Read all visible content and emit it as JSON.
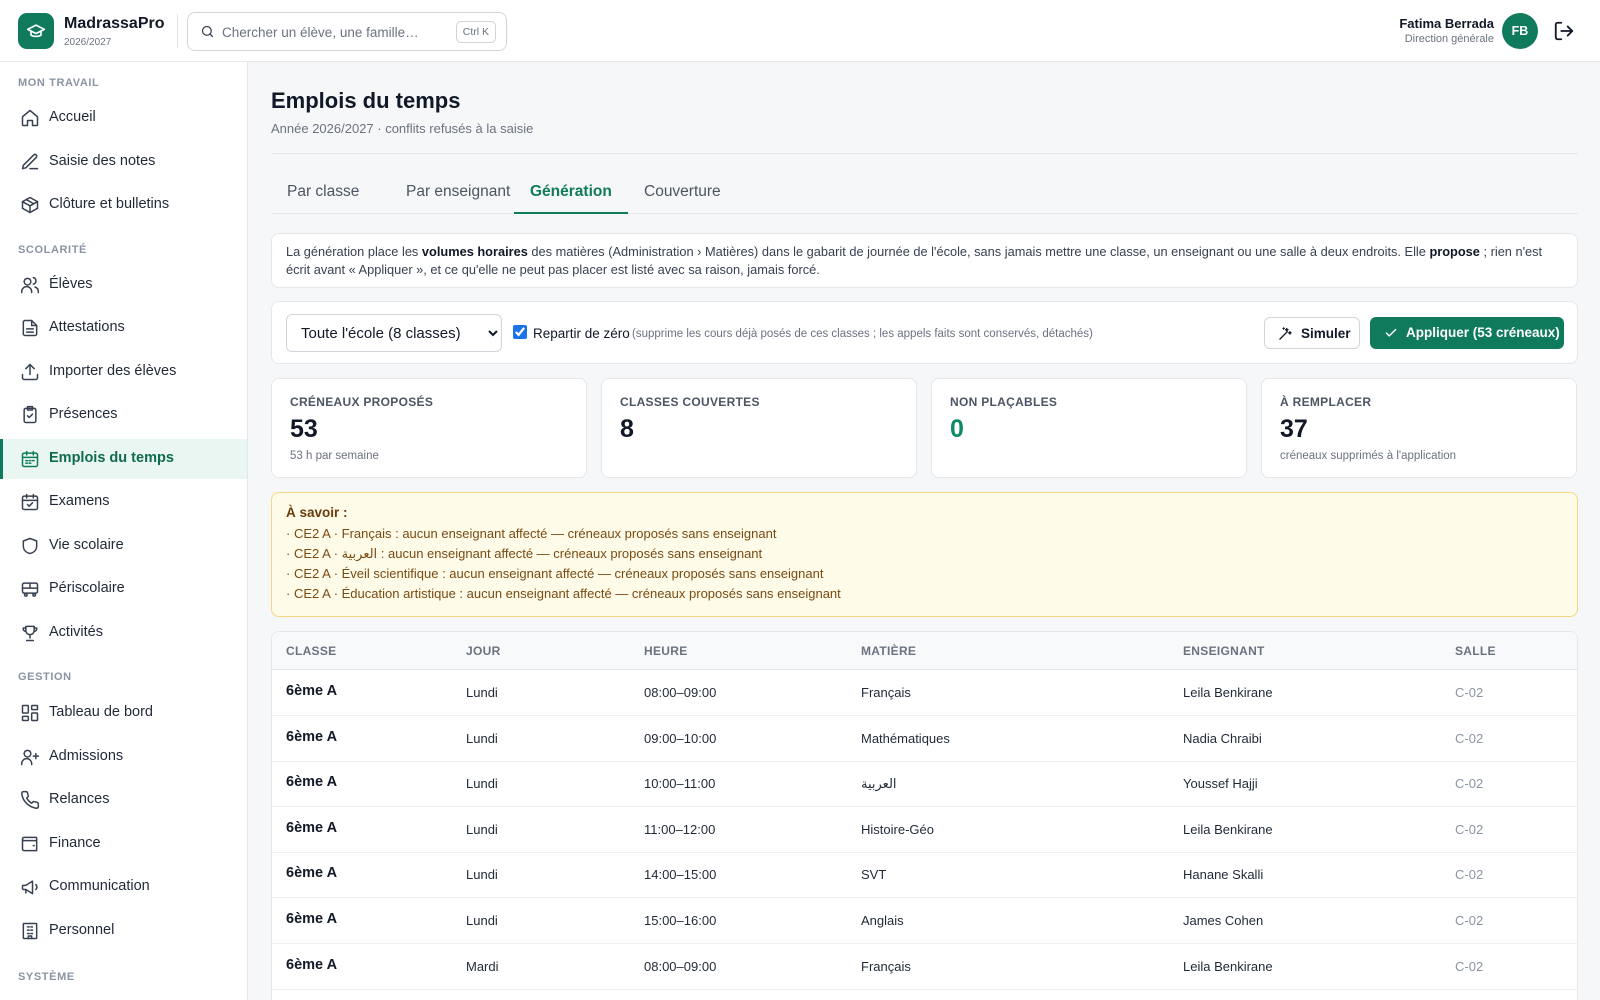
{
  "app": {
    "name": "MadrassaPro",
    "year": "2026/2027"
  },
  "search": {
    "placeholder": "Chercher un élève, une famille…",
    "shortcut": "Ctrl K"
  },
  "user": {
    "name": "Fatima Berrada",
    "role": "Direction générale",
    "initials": "FB"
  },
  "sidebar": {
    "sections": [
      {
        "title": "MON TRAVAIL",
        "items": [
          {
            "label": "Accueil",
            "icon": "home-icon"
          },
          {
            "label": "Saisie des notes",
            "icon": "pencil-icon"
          },
          {
            "label": "Clôture et bulletins",
            "icon": "package-icon"
          }
        ]
      },
      {
        "title": "SCOLARITÉ",
        "items": [
          {
            "label": "Élèves",
            "icon": "users-icon"
          },
          {
            "label": "Attestations",
            "icon": "document-icon"
          },
          {
            "label": "Importer des élèves",
            "icon": "upload-icon"
          },
          {
            "label": "Présences",
            "icon": "clipboard-check-icon"
          },
          {
            "label": "Emplois du temps",
            "icon": "calendar-icon",
            "active": true
          },
          {
            "label": "Examens",
            "icon": "calendar-check-icon"
          },
          {
            "label": "Vie scolaire",
            "icon": "shield-icon"
          },
          {
            "label": "Périscolaire",
            "icon": "bus-icon"
          },
          {
            "label": "Activités",
            "icon": "trophy-icon"
          }
        ]
      },
      {
        "title": "GESTION",
        "items": [
          {
            "label": "Tableau de bord",
            "icon": "dashboard-icon"
          },
          {
            "label": "Admissions",
            "icon": "user-plus-icon"
          },
          {
            "label": "Relances",
            "icon": "phone-icon"
          },
          {
            "label": "Finance",
            "icon": "wallet-icon"
          },
          {
            "label": "Communication",
            "icon": "megaphone-icon"
          },
          {
            "label": "Personnel",
            "icon": "building-icon"
          }
        ]
      },
      {
        "title": "SYSTÈME",
        "items": []
      }
    ]
  },
  "page": {
    "title": "Emplois du temps",
    "subtitle": "Année 2026/2027 · conflits refusés à la saisie",
    "tabs": [
      "Par classe",
      "Par enseignant",
      "Génération",
      "Couverture"
    ],
    "active_tab": "Génération"
  },
  "info": {
    "p1": "La génération place les ",
    "b1": "volumes horaires",
    "p2": " des matières (Administration › Matières) dans le gabarit de journée de l'école, sans jamais mettre une classe, un enseignant ou une salle à deux endroits. Elle ",
    "b2": "propose",
    "p3": " ; rien n'est écrit avant « Appliquer », et ce qu'elle ne peut pas placer est listé avec sa raison, jamais forcé."
  },
  "controls": {
    "scope": "Toute l'école (8 classes)",
    "from_scratch_label": "Repartir de zéro",
    "from_scratch_checked": true,
    "from_scratch_note": "(supprime les cours déjà posés de ces classes ; les appels faits sont conservés, détachés)",
    "simulate_label": "Simuler",
    "apply_label": "Appliquer (53 créneaux)"
  },
  "kpis": [
    {
      "label": "CRÉNEAUX PROPOSÉS",
      "value": "53",
      "sub": "53 h par semaine"
    },
    {
      "label": "CLASSES COUVERTES",
      "value": "8",
      "sub": ""
    },
    {
      "label": "NON PLAÇABLES",
      "value": "0",
      "sub": "",
      "color": "#0f8a66"
    },
    {
      "label": "À REMPLACER",
      "value": "37",
      "sub": "créneaux supprimés à l'application"
    }
  ],
  "warning": {
    "title": "À savoir :",
    "lines": [
      "· CE2 A · Français : aucun enseignant affecté — créneaux proposés sans enseignant",
      "· CE2 A · العربية : aucun enseignant affecté — créneaux proposés sans enseignant",
      "· CE2 A · Éveil scientifique : aucun enseignant affecté — créneaux proposés sans enseignant",
      "· CE2 A · Éducation artistique : aucun enseignant affecté — créneaux proposés sans enseignant"
    ]
  },
  "table": {
    "headers": [
      "CLASSE",
      "JOUR",
      "HEURE",
      "MATIÈRE",
      "ENSEIGNANT",
      "SALLE"
    ],
    "rows": [
      [
        "6ème A",
        "Lundi",
        "08:00–09:00",
        "Français",
        "Leila Benkirane",
        "C-02"
      ],
      [
        "6ème A",
        "Lundi",
        "09:00–10:00",
        "Mathématiques",
        "Nadia Chraibi",
        "C-02"
      ],
      [
        "6ème A",
        "Lundi",
        "10:00–11:00",
        "العربية",
        "Youssef Hajji",
        "C-02"
      ],
      [
        "6ème A",
        "Lundi",
        "11:00–12:00",
        "Histoire-Géo",
        "Leila Benkirane",
        "C-02"
      ],
      [
        "6ème A",
        "Lundi",
        "14:00–15:00",
        "SVT",
        "Hanane Skalli",
        "C-02"
      ],
      [
        "6ème A",
        "Lundi",
        "15:00–16:00",
        "Anglais",
        "James Cohen",
        "C-02"
      ],
      [
        "6ème A",
        "Mardi",
        "08:00–09:00",
        "Français",
        "Leila Benkirane",
        "C-02"
      ]
    ]
  },
  "colors": {
    "brand": "#0f7a5c",
    "active_bg": "#eaf6f1",
    "warning_bg": "#fefbe8",
    "warning_border": "#f5d682"
  }
}
